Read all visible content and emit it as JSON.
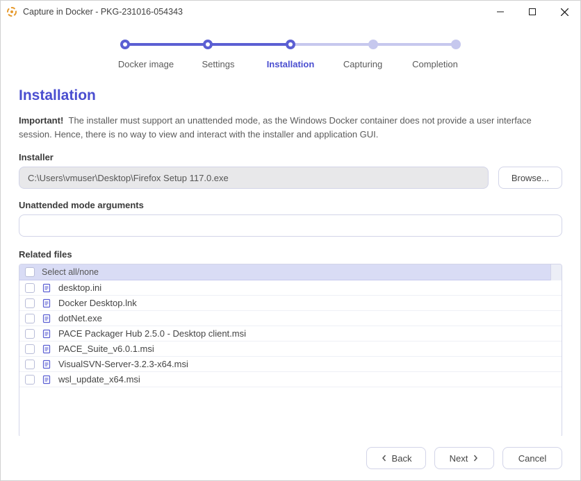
{
  "window": {
    "title": "Capture in Docker - PKG-231016-054343"
  },
  "stepper": {
    "steps": [
      {
        "label": "Docker image",
        "state": "done"
      },
      {
        "label": "Settings",
        "state": "done"
      },
      {
        "label": "Installation",
        "state": "active"
      },
      {
        "label": "Capturing",
        "state": "todo"
      },
      {
        "label": "Completion",
        "state": "todo"
      }
    ]
  },
  "page": {
    "title": "Installation",
    "important_label": "Important!",
    "important_text": "The installer must support an unattended mode, as the Windows Docker container does not provide a user interface session. Hence, there is no way to view and interact with the installer and application GUI."
  },
  "installer": {
    "label": "Installer",
    "value": "C:\\Users\\vmuser\\Desktop\\Firefox Setup 117.0.exe",
    "browse_label": "Browse..."
  },
  "args": {
    "label": "Unattended mode arguments",
    "value": ""
  },
  "related": {
    "label": "Related files",
    "select_all_label": "Select all/none",
    "files": [
      {
        "name": "desktop.ini",
        "checked": false
      },
      {
        "name": "Docker Desktop.lnk",
        "checked": false
      },
      {
        "name": "dotNet.exe",
        "checked": false
      },
      {
        "name": "PACE Packager Hub 2.5.0 - Desktop client.msi",
        "checked": false
      },
      {
        "name": "PACE_Suite_v6.0.1.msi",
        "checked": false
      },
      {
        "name": "VisualSVN-Server-3.2.3-x64.msi",
        "checked": false
      },
      {
        "name": "wsl_update_x64.msi",
        "checked": false
      }
    ]
  },
  "footer": {
    "back": "Back",
    "next": "Next",
    "cancel": "Cancel"
  }
}
